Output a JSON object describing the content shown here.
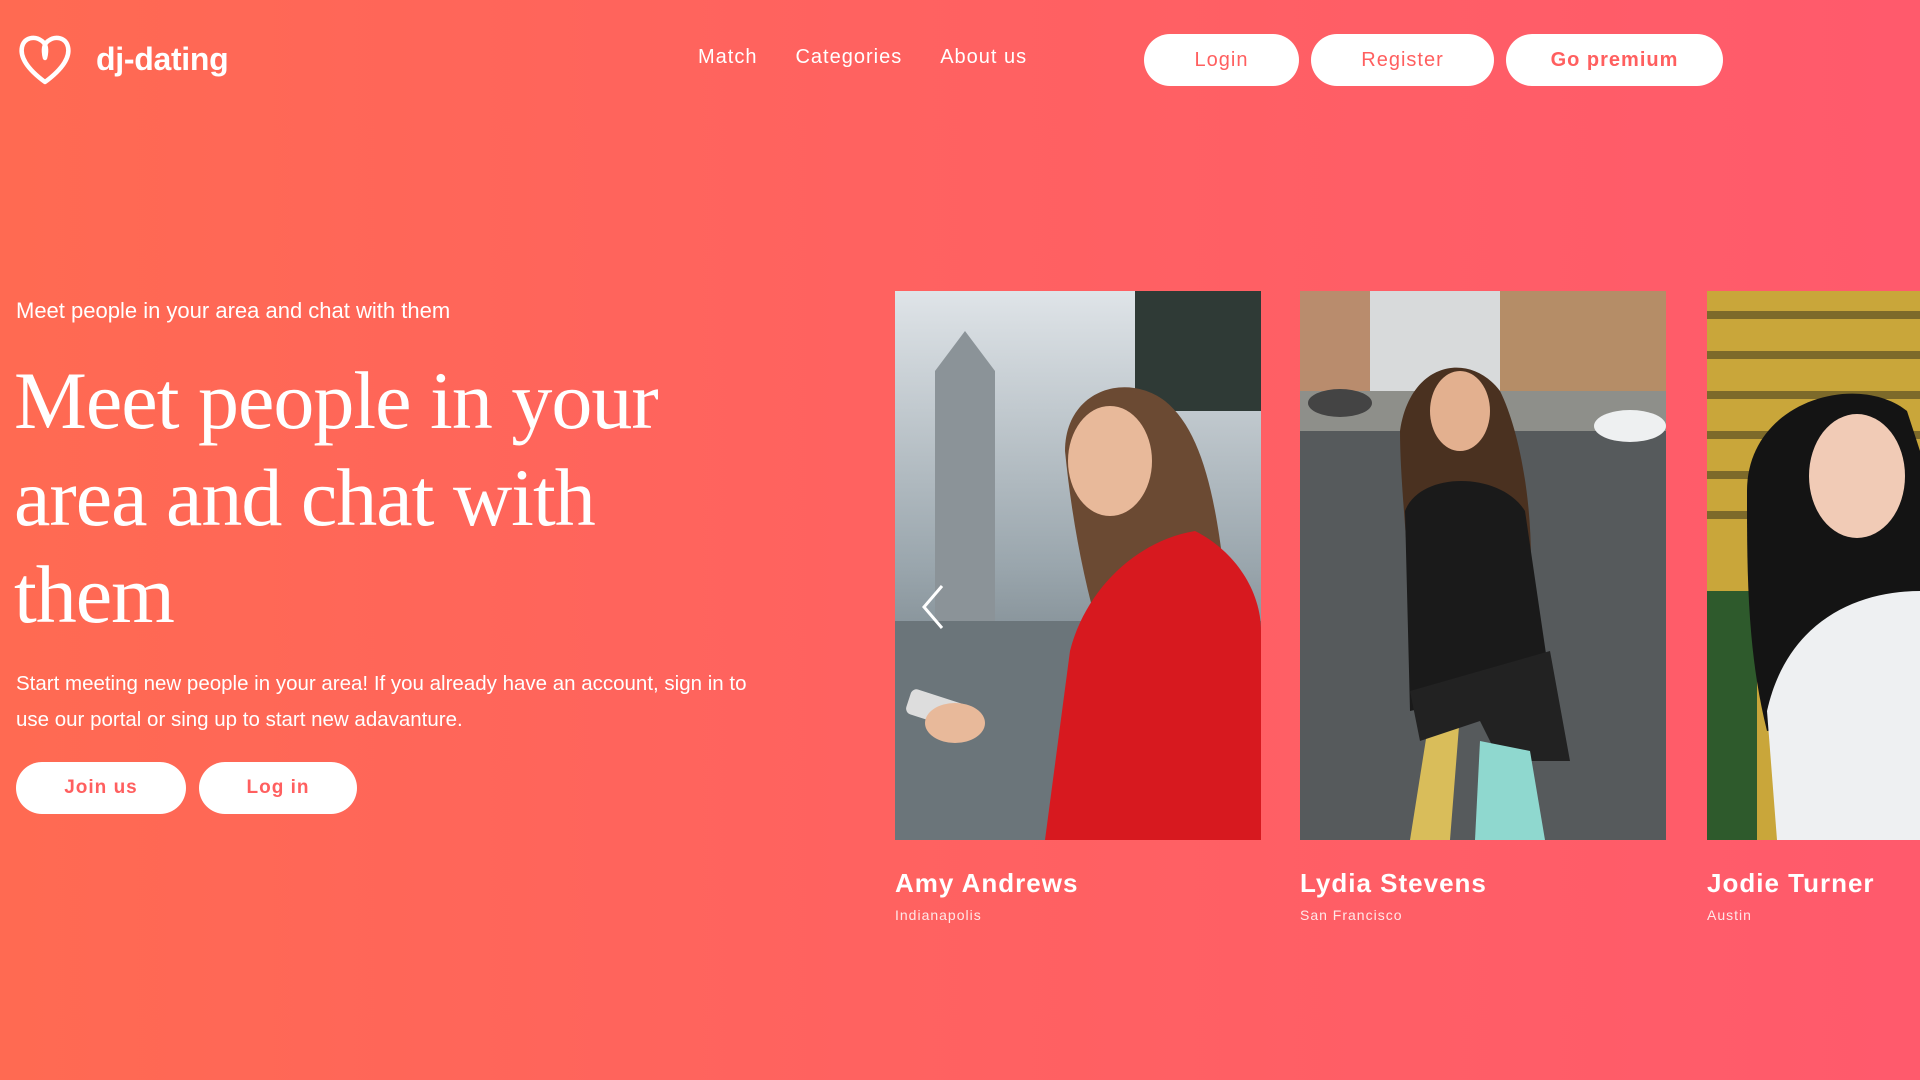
{
  "brand": {
    "name": "dj-dating",
    "logo_icon": "heart-outline-icon"
  },
  "nav": {
    "items": [
      "Match",
      "Categories",
      "About us"
    ]
  },
  "auth": {
    "login": "Login",
    "register": "Register",
    "premium": "Go premium"
  },
  "hero": {
    "eyebrow": "Meet people in your area and chat with them",
    "headline": "Meet people in your area and chat with them",
    "description": "Start meeting new people in your area! If you already have an account, sign in to use our portal or sing up to start new adavanture.",
    "join_label": "Join us",
    "login_label": "Log in"
  },
  "profiles": [
    {
      "name": "Amy Andrews",
      "city": "Indianapolis"
    },
    {
      "name": "Lydia Stevens",
      "city": "San Francisco"
    },
    {
      "name": "Jodie Turner",
      "city": "Austin"
    }
  ],
  "carousel": {
    "prev_icon": "chevron-left-icon"
  },
  "colors": {
    "accent": "#ff5f5f",
    "gradient_start": "#ff6a52",
    "gradient_end": "#ff5a6c"
  }
}
